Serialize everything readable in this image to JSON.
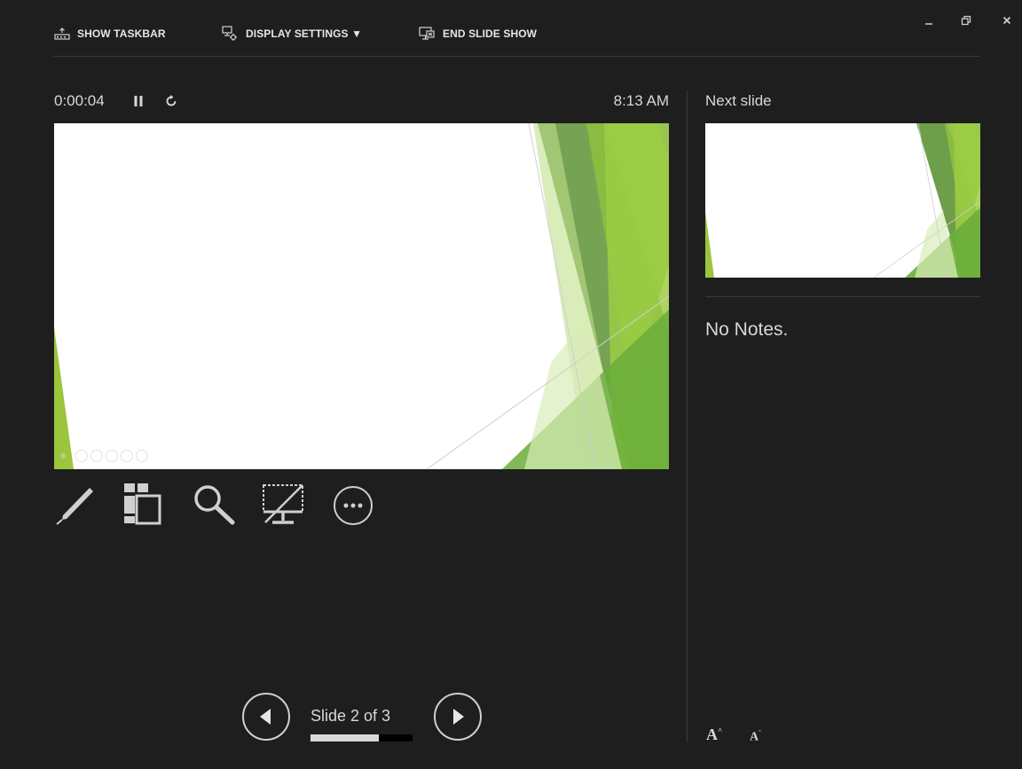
{
  "toolbar": {
    "show_taskbar": "SHOW TASKBAR",
    "display_settings": "DISPLAY SETTINGS ▼",
    "end_slide_show": "END SLIDE SHOW"
  },
  "window_controls": [
    "minimize-icon",
    "restore-icon",
    "close-icon"
  ],
  "presenter": {
    "timer": "0:00:04",
    "clock": "8:13 AM",
    "tools": [
      "pen-icon",
      "see-all-slides-icon",
      "zoom-icon",
      "black-screen-icon",
      "more-options-icon"
    ],
    "slide_counter": "Slide 2 of 3",
    "progress": 0.667
  },
  "next_slide": {
    "label": "Next slide"
  },
  "notes": {
    "text": "No Notes.",
    "increase_font": "A",
    "decrease_font": "A"
  },
  "colors": {
    "background": "#1e1e1e",
    "green_light": "#9bc53d",
    "green_dark": "#5e9a35",
    "text": "#d8d8d8"
  }
}
